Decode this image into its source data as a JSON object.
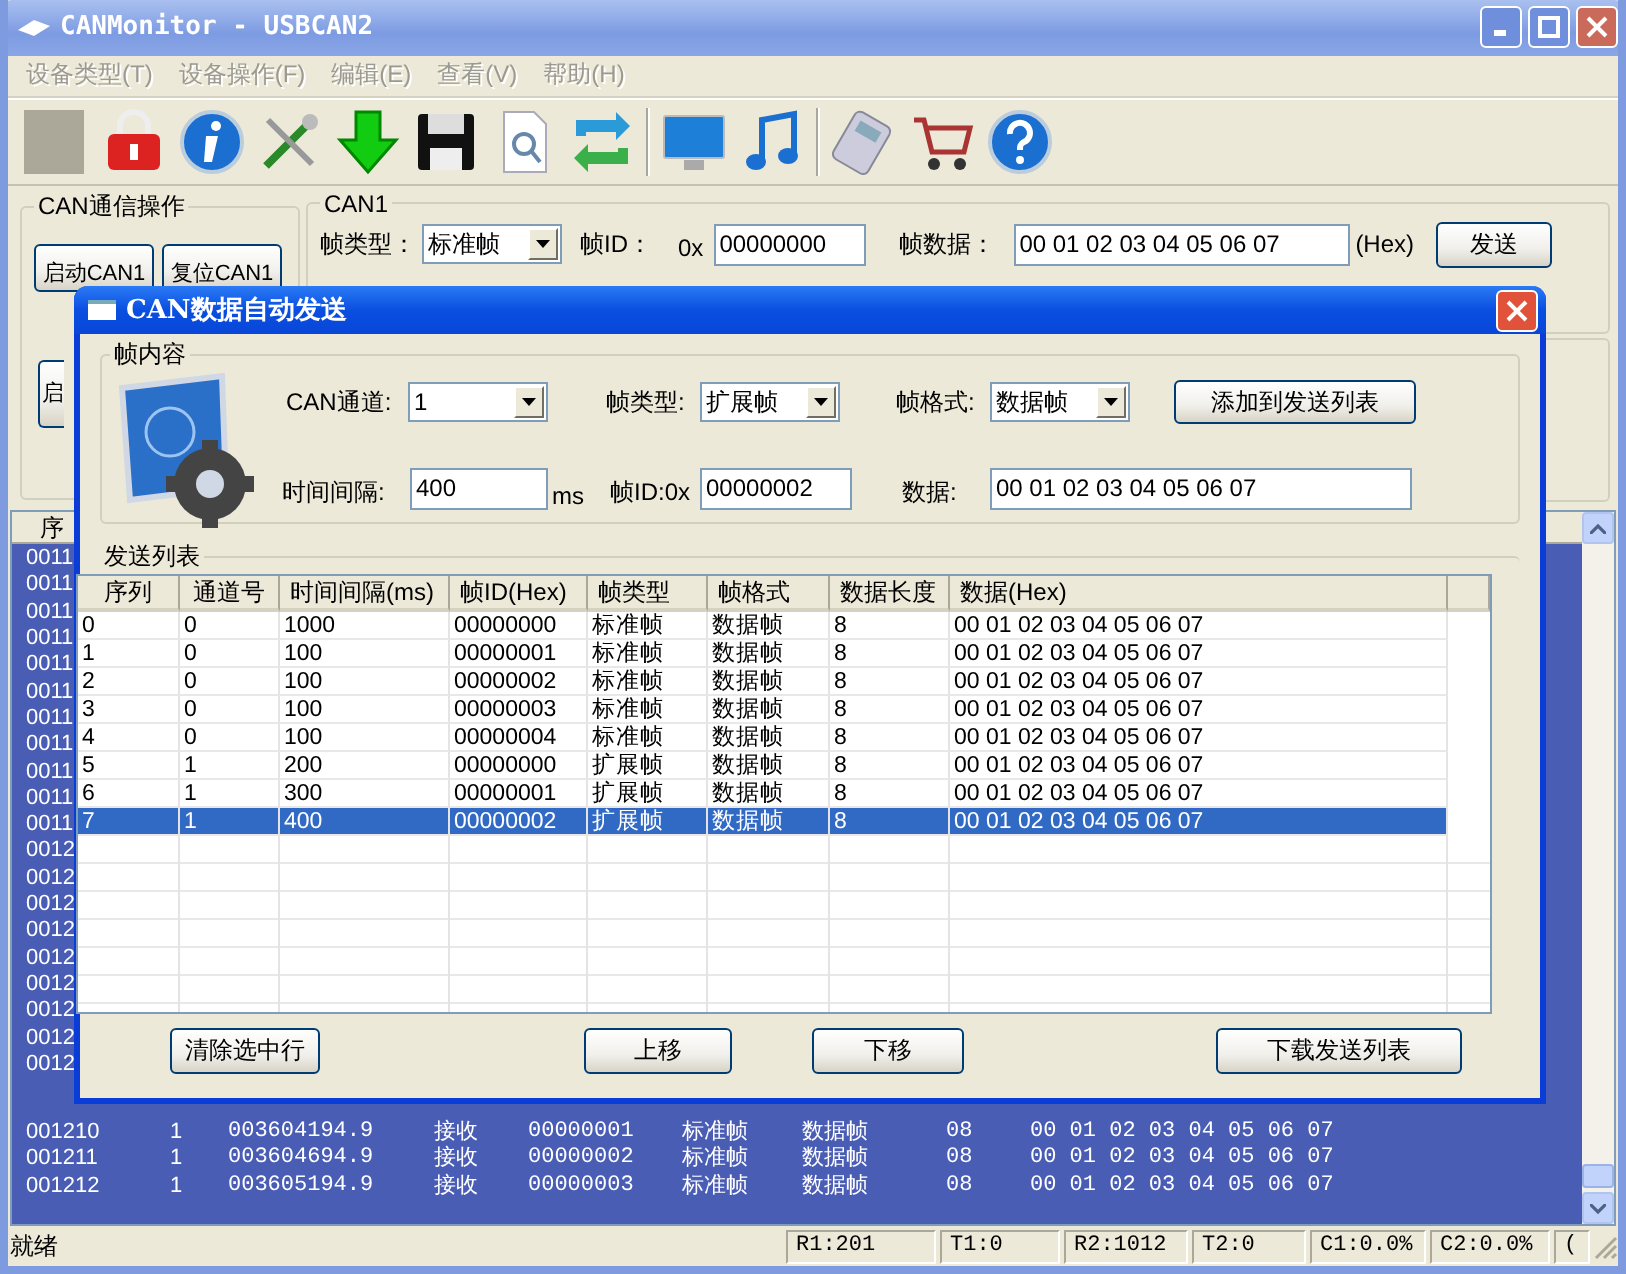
{
  "window": {
    "title": "CANMonitor - USBCAN2"
  },
  "menu": [
    {
      "label": "设备类型(T)",
      "disabled": true
    },
    {
      "label": "设备操作(F)",
      "disabled": true
    },
    {
      "label": "编辑(E)",
      "disabled": true
    },
    {
      "label": "查看(V)",
      "disabled": true
    },
    {
      "label": "帮助(H)",
      "disabled": true
    }
  ],
  "comm_group": {
    "title": "CAN通信操作",
    "buttons": [
      "启动CAN1",
      "复位CAN1",
      "启"
    ]
  },
  "can1": {
    "title": "CAN1",
    "frame_type_label": "帧类型：",
    "frame_type": "标准帧",
    "id_label": "帧ID：",
    "id_prefix": "0x",
    "id": "00000000",
    "data_label": "帧数据：",
    "data": "00 01 02 03 04 05 06 07",
    "hex_label": "(Hex)",
    "send_button": "发送"
  },
  "log": {
    "header": "序",
    "hidden_rows": [
      "0011",
      "0011",
      "0011",
      "0011",
      "0011",
      "0011",
      "0011",
      "0011",
      "0011",
      "0011",
      "0011",
      "0012",
      "0012",
      "0012",
      "0012",
      "0012",
      "0012",
      "0012",
      "0012",
      "0012"
    ],
    "rows": [
      [
        "001210",
        "1",
        "003604194.9",
        "接收",
        "00000001",
        "标准帧",
        "数据帧",
        "08",
        "00 01 02 03 04 05 06 07"
      ],
      [
        "001211",
        "1",
        "003604694.9",
        "接收",
        "00000002",
        "标准帧",
        "数据帧",
        "08",
        "00 01 02 03 04 05 06 07"
      ],
      [
        "001212",
        "1",
        "003605194.9",
        "接收",
        "00000003",
        "标准帧",
        "数据帧",
        "08",
        "00 01 02 03 04 05 06 07"
      ]
    ]
  },
  "status_bar": {
    "text": "就绪",
    "panes": [
      "R1:201",
      "T1:0",
      "R2:1012",
      "T2:0",
      "C1:0.0%",
      "C2:0.0%",
      "("
    ]
  },
  "dialog": {
    "title": "CAN数据自动发送",
    "frame_group": {
      "title": "帧内容",
      "channel_label": "CAN通道:",
      "channel": "1",
      "type_label": "帧类型:",
      "type": "扩展帧",
      "format_label": "帧格式:",
      "format": "数据帧",
      "add_button": "添加到发送列表",
      "interval_label": "时间间隔:",
      "interval": "400",
      "interval_unit": "ms",
      "id_label": "帧ID:0x",
      "id": "00000002",
      "data_label": "数据:",
      "data": "00 01 02 03 04 05 06 07"
    },
    "send_list": {
      "title": "发送列表",
      "columns": [
        "序列",
        "通道号",
        "时间间隔(ms)",
        "帧ID(Hex)",
        "帧类型",
        "帧格式",
        "数据长度",
        "数据(Hex)"
      ],
      "rows": [
        {
          "cells": [
            "0",
            "0",
            "1000",
            "00000000",
            "标准帧",
            "数据帧",
            "8",
            "00 01 02 03 04 05 06 07"
          ],
          "selected": false
        },
        {
          "cells": [
            "1",
            "0",
            "100",
            "00000001",
            "标准帧",
            "数据帧",
            "8",
            "00 01 02 03 04 05 06 07"
          ],
          "selected": false
        },
        {
          "cells": [
            "2",
            "0",
            "100",
            "00000002",
            "标准帧",
            "数据帧",
            "8",
            "00 01 02 03 04 05 06 07"
          ],
          "selected": false
        },
        {
          "cells": [
            "3",
            "0",
            "100",
            "00000003",
            "标准帧",
            "数据帧",
            "8",
            "00 01 02 03 04 05 06 07"
          ],
          "selected": false
        },
        {
          "cells": [
            "4",
            "0",
            "100",
            "00000004",
            "标准帧",
            "数据帧",
            "8",
            "00 01 02 03 04 05 06 07"
          ],
          "selected": false
        },
        {
          "cells": [
            "5",
            "1",
            "200",
            "00000000",
            "扩展帧",
            "数据帧",
            "8",
            "00 01 02 03 04 05 06 07"
          ],
          "selected": false
        },
        {
          "cells": [
            "6",
            "1",
            "300",
            "00000001",
            "扩展帧",
            "数据帧",
            "8",
            "00 01 02 03 04 05 06 07"
          ],
          "selected": false
        },
        {
          "cells": [
            "7",
            "1",
            "400",
            "00000002",
            "扩展帧",
            "数据帧",
            "8",
            "00 01 02 03 04 05 06 07"
          ],
          "selected": true
        }
      ]
    },
    "buttons": [
      "清除选中行",
      "上移",
      "下移",
      "下载发送列表"
    ]
  }
}
